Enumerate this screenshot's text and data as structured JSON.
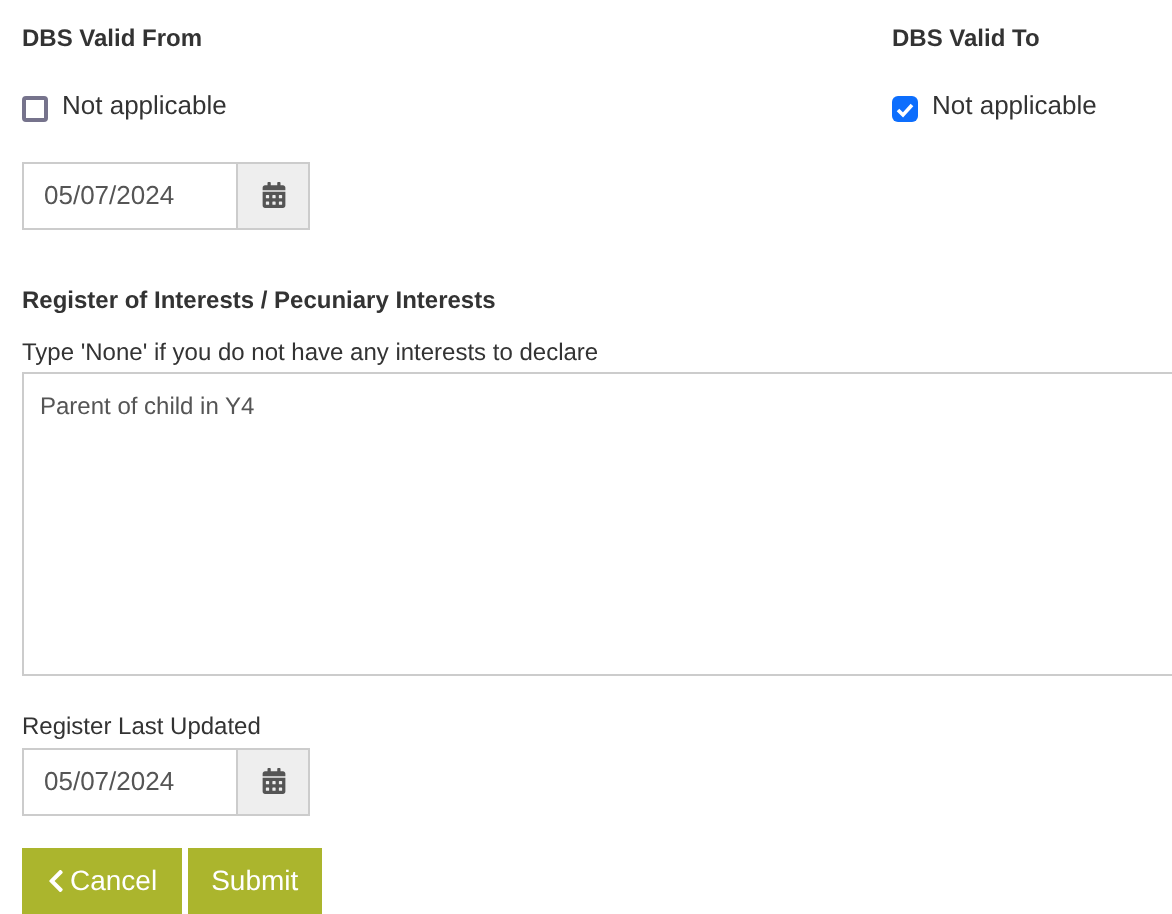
{
  "dbs_valid_from": {
    "label": "DBS Valid From",
    "not_applicable": {
      "label": "Not applicable",
      "checked": false
    },
    "date": "05/07/2024"
  },
  "dbs_valid_to": {
    "label": "DBS Valid To",
    "not_applicable": {
      "label": "Not applicable",
      "checked": true
    }
  },
  "interests": {
    "heading": "Register of Interests / Pecuniary Interests",
    "hint": "Type 'None' if you do not have any interests to declare",
    "value": "Parent of child in Y4"
  },
  "register_last_updated": {
    "label": "Register Last Updated",
    "date": "05/07/2024"
  },
  "buttons": [
    {
      "kind": "back",
      "label": "Cancel"
    },
    {
      "kind": "primary",
      "label": "Submit"
    }
  ]
}
